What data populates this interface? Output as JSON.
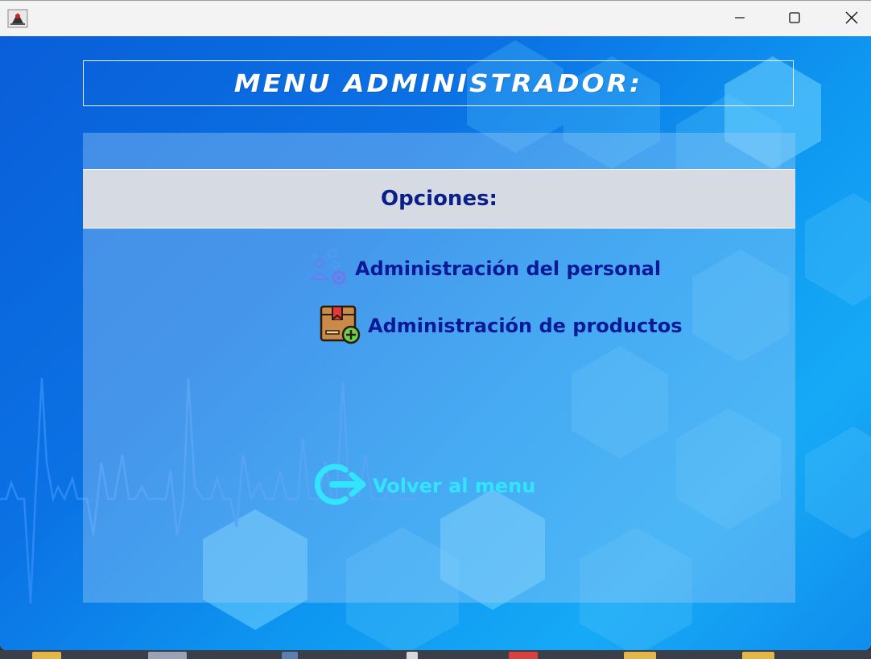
{
  "window": {
    "app_icon": "java-duke-icon",
    "controls": [
      "minimize-icon",
      "maximize-icon",
      "close-icon"
    ]
  },
  "header": {
    "title": "MENU ADMINISTRADOR:"
  },
  "options": {
    "heading": "Opciones:",
    "items": [
      {
        "label": "Administración del personal",
        "icon": "staff-management-icon"
      },
      {
        "label": "Administración de productos",
        "icon": "product-box-add-icon"
      }
    ],
    "back": {
      "label": "Volver al menu",
      "icon": "logout-arrow-icon"
    }
  },
  "colors": {
    "accent_text": "#0a1a96",
    "back_text": "#33e4ff",
    "header_bg": "#d6dae3",
    "background": "#0b72e4"
  }
}
